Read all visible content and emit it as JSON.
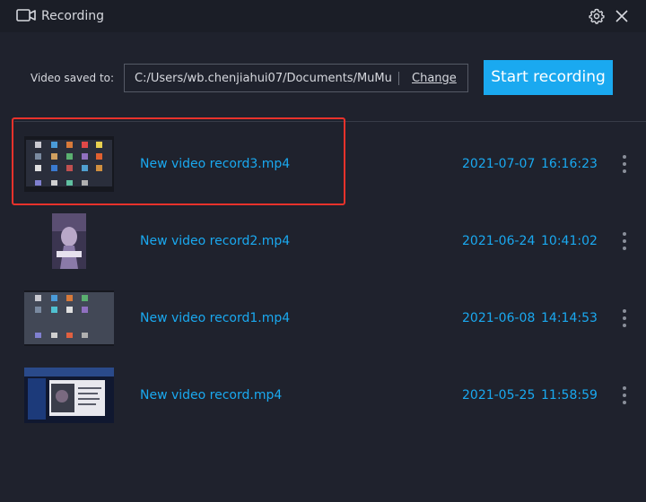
{
  "window": {
    "title": "Recording",
    "icon": "video-camera-icon"
  },
  "save": {
    "label": "Video saved to:",
    "path": "C:/Users/wb.chenjiahui07/Documents/MuMu",
    "change_label": "Change"
  },
  "start_button_label": "Start recording",
  "recordings": [
    {
      "name": "New video record3.mp4",
      "date": "2021-07-07",
      "time": "16:16:23",
      "thumb": "desktop-grid"
    },
    {
      "name": "New video record2.mp4",
      "date": "2021-06-24",
      "time": "10:41:02",
      "thumb": "portrait-game"
    },
    {
      "name": "New video record1.mp4",
      "date": "2021-06-08",
      "time": "14:14:53",
      "thumb": "desktop-grid-sparse"
    },
    {
      "name": "New video record.mp4",
      "date": "2021-05-25",
      "time": "11:58:59",
      "thumb": "game-dialog"
    }
  ],
  "colors": {
    "background": "#1f222d",
    "accent": "#1aa9f0",
    "highlight": "#e8322b"
  }
}
